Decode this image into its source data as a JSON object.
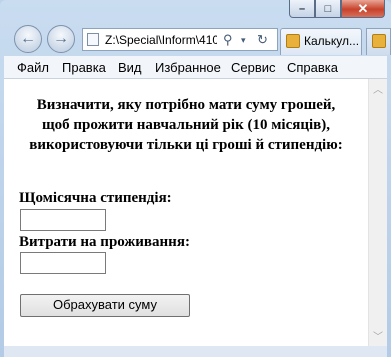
{
  "browser": {
    "address_url": "Z:\\Special\\Inform\\410",
    "tab_title": "Калькул...",
    "nav_icons": [
      "back-arrow-icon",
      "forward-arrow-icon"
    ]
  },
  "menu": [
    "Файл",
    "Правка",
    "Вид",
    "Избранное",
    "Сервис",
    "Справка"
  ],
  "page": {
    "heading_line1": "Визначити, яку потрібно мати суму грошей,",
    "heading_line2": "щоб прожити навчальний рік (10 місяців),",
    "heading_line3": "використовуючи тільки ці гроші й стипендію:",
    "stipend_label": "Щомісячна стипендія:",
    "stipend_value": "",
    "expenses_label": "Витрати на проживання:",
    "expenses_value": "",
    "calculate_button": "Обрахувати суму"
  }
}
